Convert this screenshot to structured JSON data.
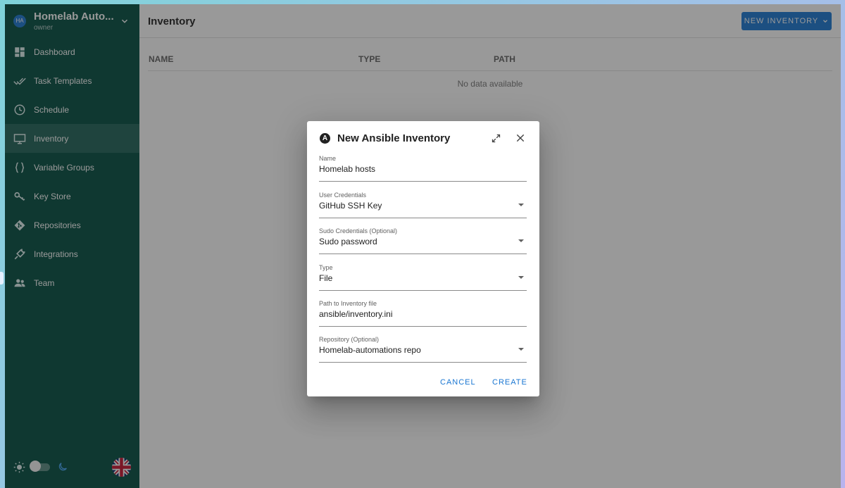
{
  "project": {
    "avatar": "HA",
    "name": "Homelab Auto...",
    "role": "owner",
    "chevron_icon": "chevron-down-icon"
  },
  "sidebar": {
    "items": [
      {
        "label": "Dashboard",
        "icon": "dashboard-icon",
        "active": false
      },
      {
        "label": "Task Templates",
        "icon": "double-check-icon",
        "active": false
      },
      {
        "label": "Schedule",
        "icon": "clock-icon",
        "active": false
      },
      {
        "label": "Inventory",
        "icon": "monitor-icon",
        "active": true
      },
      {
        "label": "Variable Groups",
        "icon": "braces-icon",
        "active": false
      },
      {
        "label": "Key Store",
        "icon": "key-icon",
        "active": false
      },
      {
        "label": "Repositories",
        "icon": "git-icon",
        "active": false
      },
      {
        "label": "Integrations",
        "icon": "plug-icon",
        "active": false
      },
      {
        "label": "Team",
        "icon": "team-icon",
        "active": false
      }
    ],
    "theme": {
      "light_icon": "sun-icon",
      "dark_icon": "moon-icon",
      "language_icon": "uk-flag-icon"
    }
  },
  "main": {
    "title": "Inventory",
    "new_button": "NEW INVENTORY",
    "table": {
      "columns": [
        "NAME",
        "TYPE",
        "PATH"
      ],
      "empty_text": "No data available"
    }
  },
  "dialog": {
    "title": "New Ansible Inventory",
    "fields": {
      "name": {
        "label": "Name",
        "value": "Homelab hosts"
      },
      "user_credentials": {
        "label": "User Credentials",
        "value": "GitHub SSH Key"
      },
      "sudo_credentials": {
        "label": "Sudo Credentials (Optional)",
        "value": "Sudo password"
      },
      "type": {
        "label": "Type",
        "value": "File"
      },
      "path": {
        "label": "Path to Inventory file",
        "value": "ansible/inventory.ini"
      },
      "repository": {
        "label": "Repository (Optional)",
        "value": "Homelab-automations repo"
      }
    },
    "cancel": "CANCEL",
    "create": "CREATE"
  },
  "colors": {
    "sidebar_bg": "#004d40",
    "primary": "#1976d2",
    "overlay": "#212121"
  }
}
